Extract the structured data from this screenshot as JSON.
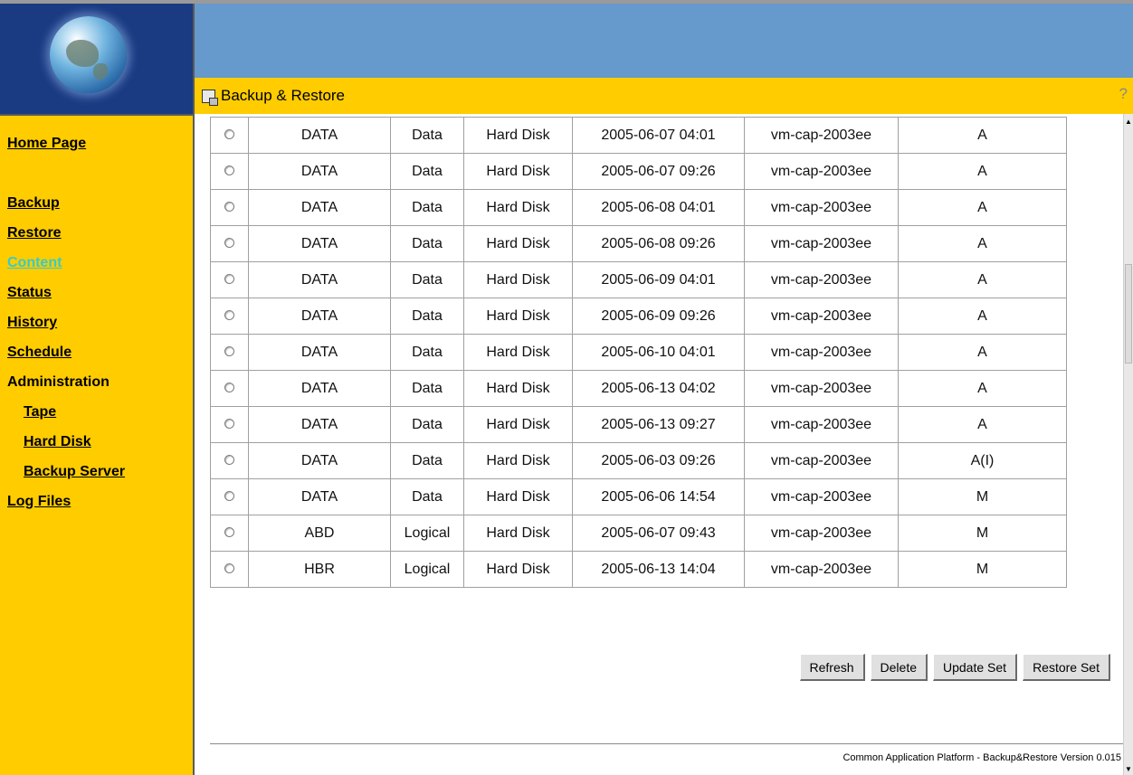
{
  "app": {
    "page_title": "Backup & Restore",
    "help_label": "?",
    "footer": "Common Application Platform - Backup&Restore Version 0.015"
  },
  "sidebar": {
    "home": "Home Page",
    "backup": "Backup",
    "restore": "Restore",
    "content": "Content",
    "status": "Status",
    "history": "History",
    "schedule": "Schedule",
    "administration": "Administration",
    "tape": "Tape",
    "hard_disk": "Hard Disk",
    "backup_server": "Backup Server",
    "log_files": "Log Files"
  },
  "table": {
    "rows": [
      {
        "name": "DATA",
        "type": "Data",
        "media": "Hard Disk",
        "date": "2005-06-07 04:01",
        "host": "vm-cap-2003ee",
        "mode": "A"
      },
      {
        "name": "DATA",
        "type": "Data",
        "media": "Hard Disk",
        "date": "2005-06-07 09:26",
        "host": "vm-cap-2003ee",
        "mode": "A"
      },
      {
        "name": "DATA",
        "type": "Data",
        "media": "Hard Disk",
        "date": "2005-06-08 04:01",
        "host": "vm-cap-2003ee",
        "mode": "A"
      },
      {
        "name": "DATA",
        "type": "Data",
        "media": "Hard Disk",
        "date": "2005-06-08 09:26",
        "host": "vm-cap-2003ee",
        "mode": "A"
      },
      {
        "name": "DATA",
        "type": "Data",
        "media": "Hard Disk",
        "date": "2005-06-09 04:01",
        "host": "vm-cap-2003ee",
        "mode": "A"
      },
      {
        "name": "DATA",
        "type": "Data",
        "media": "Hard Disk",
        "date": "2005-06-09 09:26",
        "host": "vm-cap-2003ee",
        "mode": "A"
      },
      {
        "name": "DATA",
        "type": "Data",
        "media": "Hard Disk",
        "date": "2005-06-10 04:01",
        "host": "vm-cap-2003ee",
        "mode": "A"
      },
      {
        "name": "DATA",
        "type": "Data",
        "media": "Hard Disk",
        "date": "2005-06-13 04:02",
        "host": "vm-cap-2003ee",
        "mode": "A"
      },
      {
        "name": "DATA",
        "type": "Data",
        "media": "Hard Disk",
        "date": "2005-06-13 09:27",
        "host": "vm-cap-2003ee",
        "mode": "A"
      },
      {
        "name": "DATA",
        "type": "Data",
        "media": "Hard Disk",
        "date": "2005-06-03 09:26",
        "host": "vm-cap-2003ee",
        "mode": "A(I)"
      },
      {
        "name": "DATA",
        "type": "Data",
        "media": "Hard Disk",
        "date": "2005-06-06 14:54",
        "host": "vm-cap-2003ee",
        "mode": "M"
      },
      {
        "name": "ABD",
        "type": "Logical",
        "media": "Hard Disk",
        "date": "2005-06-07 09:43",
        "host": "vm-cap-2003ee",
        "mode": "M"
      },
      {
        "name": "HBR",
        "type": "Logical",
        "media": "Hard Disk",
        "date": "2005-06-13 14:04",
        "host": "vm-cap-2003ee",
        "mode": "M"
      }
    ]
  },
  "buttons": {
    "refresh": "Refresh",
    "delete": "Delete",
    "update_set": "Update Set",
    "restore_set": "Restore Set"
  },
  "colors": {
    "sidebar_bg": "#ffcc00",
    "banner_bg": "#6699cc",
    "active_link": "#33cccc"
  }
}
